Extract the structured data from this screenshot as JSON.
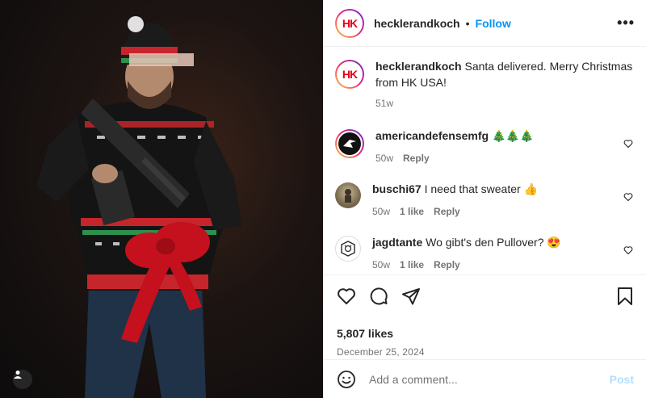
{
  "post": {
    "author": "hecklerandkoch",
    "follow_label": "Follow",
    "more_label": "•••",
    "logo_text": "HK"
  },
  "caption": {
    "username": "hecklerandkoch",
    "text": "Santa delivered. Merry Christmas from HK USA!",
    "age": "51w"
  },
  "comments": [
    {
      "username": "americandefensemfg",
      "text": "🎄🎄🎄",
      "age": "50w",
      "likes": "",
      "reply": "Reply"
    },
    {
      "username": "buschi67",
      "text": "I need that sweater 👍",
      "age": "50w",
      "likes": "1 like",
      "reply": "Reply"
    },
    {
      "username": "jagdtante",
      "text": "Wo gibt's den Pullover? 😍",
      "age": "50w",
      "likes": "1 like",
      "reply": "Reply"
    }
  ],
  "stats": {
    "likes": "5,807 likes",
    "date": "December 25, 2024"
  },
  "add_comment": {
    "placeholder": "Add a comment...",
    "post_label": "Post"
  },
  "icons": {
    "like": "heart-icon",
    "comment": "comment-icon",
    "share": "share-icon",
    "save": "bookmark-icon",
    "emoji": "emoji-icon",
    "user_tag": "user-icon"
  },
  "colors": {
    "follow": "#0095f6",
    "post_disabled": "#b2dffc",
    "brand_red": "#e3001b"
  }
}
